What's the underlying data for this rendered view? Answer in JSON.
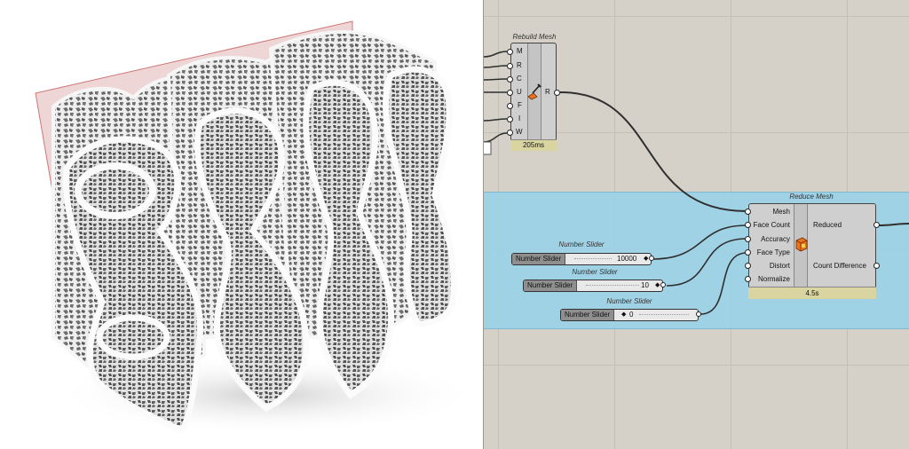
{
  "viewport": {
    "name": "Rhino perspective viewport"
  },
  "rebuild_mesh": {
    "title": "Rebuild Mesh",
    "inputs": [
      "M",
      "R",
      "C",
      "U",
      "F",
      "I",
      "W"
    ],
    "outputs": [
      "R"
    ],
    "timing": "205ms",
    "icon": "rebuild-mesh-icon"
  },
  "reduce_mesh": {
    "title": "Reduce Mesh",
    "inputs": [
      "Mesh",
      "Face Count",
      "Accuracy",
      "Face Type",
      "Distort",
      "Normalize"
    ],
    "outputs": [
      "Reduced",
      "Count Difference"
    ],
    "timing": "4.5s",
    "icon": "reduce-mesh-icon"
  },
  "sliders": [
    {
      "title": "Number Slider",
      "label": "Number Slider",
      "value": "10000"
    },
    {
      "title": "Number Slider",
      "label": "Number Slider",
      "value": "10"
    },
    {
      "title": "Number Slider",
      "label": "Number Slider",
      "value": "0"
    }
  ],
  "colors": {
    "canvas": "#d5d1c8",
    "group": "#96d2eb",
    "component": "#cfcfcf",
    "timing_bar": "#d9d4a0",
    "mesh": "#e8e8e8",
    "plane": "#e9c8c8"
  }
}
